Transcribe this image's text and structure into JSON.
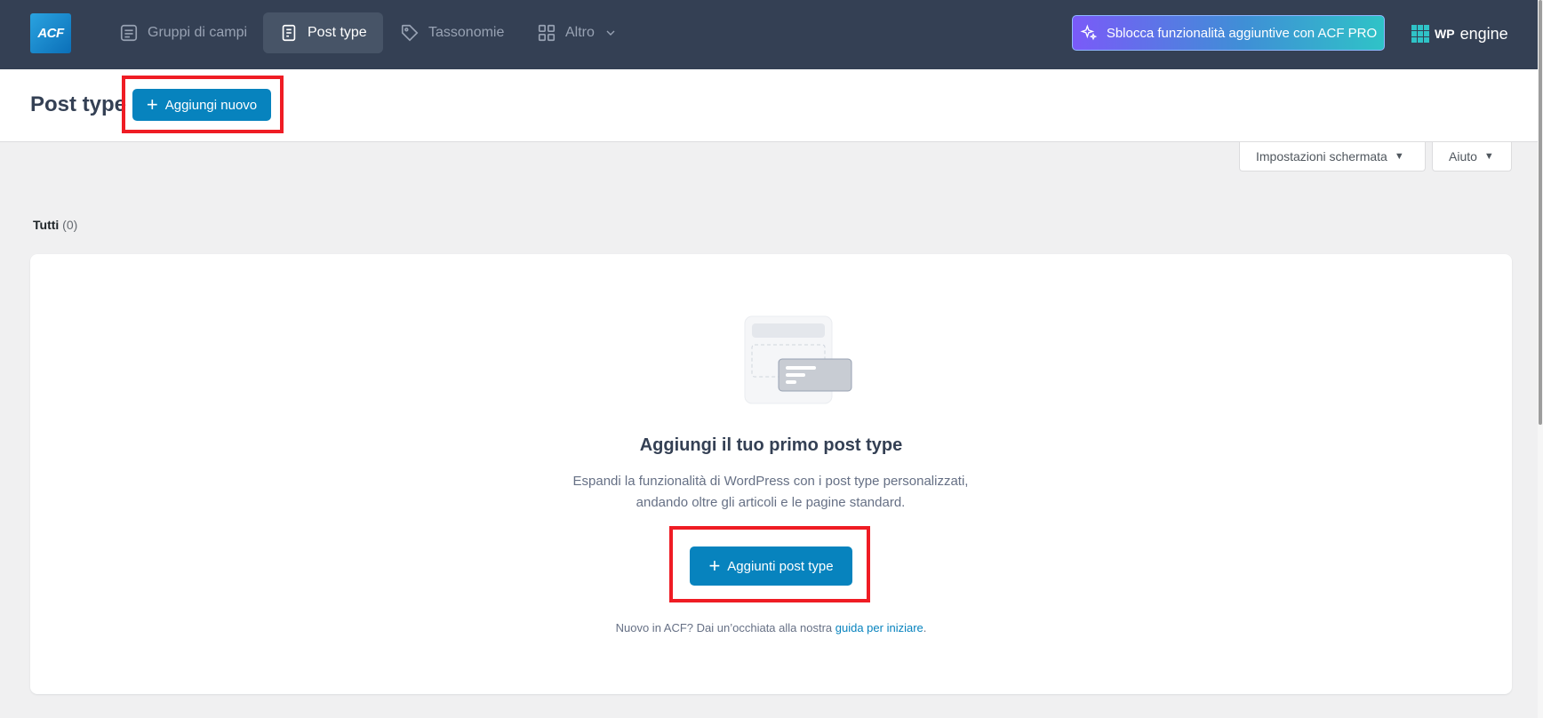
{
  "topbar": {
    "logo_text": "ACF",
    "tabs": [
      {
        "label": "Gruppi di campi",
        "icon": "field-groups-icon",
        "active": false
      },
      {
        "label": "Post type",
        "icon": "post-type-icon",
        "active": true
      },
      {
        "label": "Tassonomie",
        "icon": "tag-icon",
        "active": false
      },
      {
        "label": "Altro",
        "icon": "grid-icon",
        "active": false
      }
    ],
    "pro_button_label": "Sblocca funzionalità aggiuntive con ACF PRO",
    "brand": {
      "wp": "WP",
      "engine": "engine"
    }
  },
  "header": {
    "title": "Post type",
    "add_new_label": "Aggiungi nuovo"
  },
  "screen_options": {
    "screen_label": "Impostazioni schermata",
    "help_label": "Aiuto"
  },
  "filter": {
    "label": "Tutti",
    "count": "(0)"
  },
  "empty_state": {
    "title": "Aggiungi il tuo primo post type",
    "description_line1": "Espandi la funzionalità di WordPress con i post type personalizzati,",
    "description_line2": "andando oltre gli articoli e le pagine standard.",
    "button_label": "Aggiunti post type",
    "guide_prefix": "Nuovo in ACF? Dai un’occhiata alla nostra ",
    "guide_link": "guida per iniziare",
    "guide_suffix": "."
  },
  "colors": {
    "topbar": "#344054",
    "primary_button": "#0783be",
    "highlight": "#ef1c24"
  }
}
